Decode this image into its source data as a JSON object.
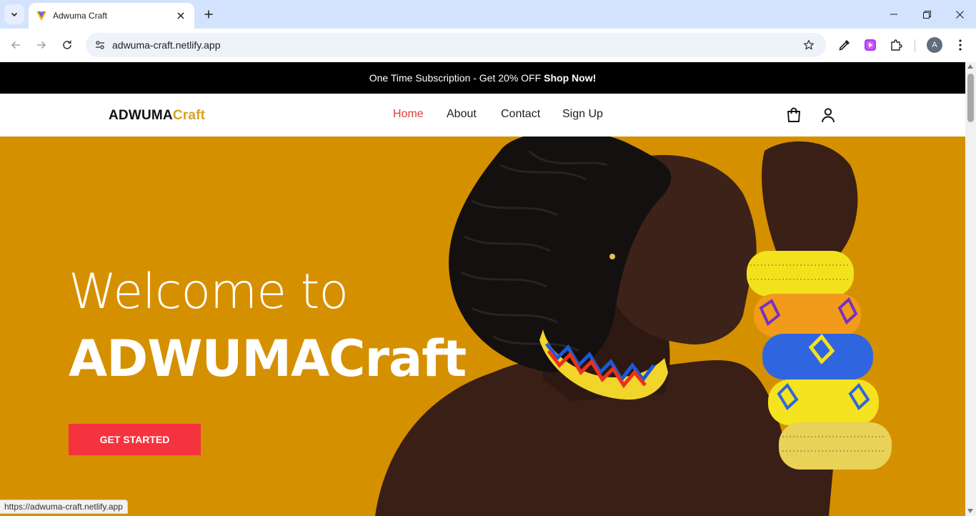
{
  "browser": {
    "tab_title": "Adwuma Craft",
    "url": "adwuma-craft.netlify.app",
    "profile_initial": "A",
    "status_url": "https://adwuma-craft.netlify.app"
  },
  "promo": {
    "text": "One Time Subscription - Get 20% OFF",
    "link": "Shop Now!"
  },
  "site_nav": {
    "logo_main": "ADWUMA",
    "logo_accent": "Craft",
    "items": [
      {
        "label": "Home",
        "active": true
      },
      {
        "label": "About",
        "active": false
      },
      {
        "label": "Contact",
        "active": false
      },
      {
        "label": "Sign Up",
        "active": false
      }
    ]
  },
  "hero": {
    "welcome": "Welcome to",
    "brand": "ADWUMACraft",
    "cta": "GET STARTED"
  },
  "colors": {
    "hero_bg": "#d59000",
    "accent": "#d9a21d",
    "cta": "#f5333f",
    "active_nav": "#e23b3b"
  },
  "icons": [
    "tab-list-icon",
    "favicon-icon",
    "close-icon",
    "plus-icon",
    "minimize-icon",
    "restore-icon",
    "back-icon",
    "forward-icon",
    "reload-icon",
    "site-settings-icon",
    "star-icon",
    "eyedropper-icon",
    "extension-video-icon",
    "puzzle-icon",
    "kebab-icon",
    "cart-icon",
    "user-icon"
  ]
}
